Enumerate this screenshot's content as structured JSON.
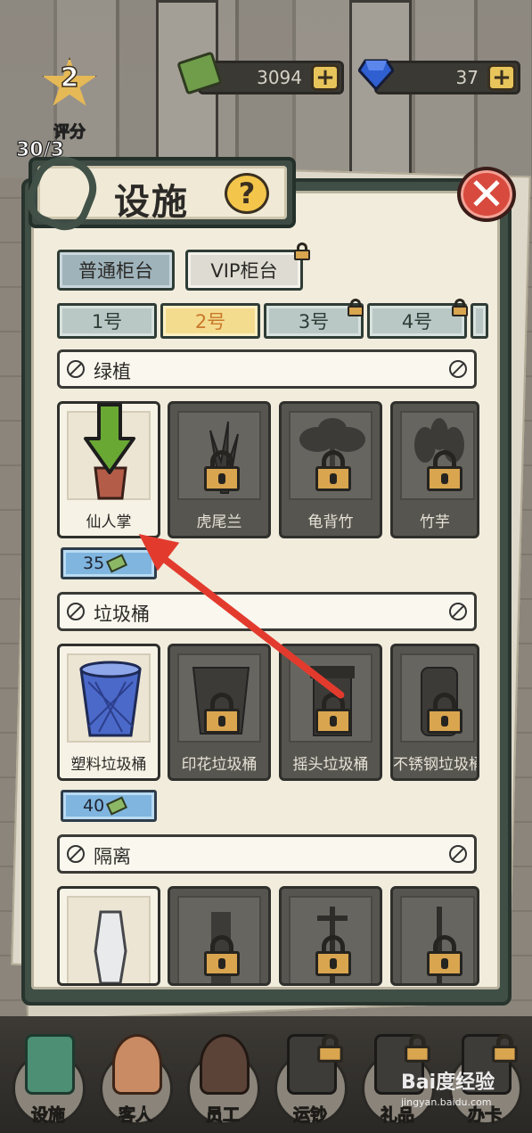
{
  "hud": {
    "cash_value": "3094",
    "gem_value": "37",
    "plus_symbol": "+",
    "rank_number": "2",
    "rank_label": "评分",
    "rank_progress": "30/3"
  },
  "panel": {
    "title": "设施",
    "help_symbol": "?",
    "close_symbol": "✕",
    "counter_tabs": [
      {
        "label": "普通柜台",
        "state": "active"
      },
      {
        "label": "VIP柜台",
        "state": "locked"
      }
    ],
    "number_tabs": [
      {
        "label": "1号",
        "state": "normal"
      },
      {
        "label": "2号",
        "state": "active"
      },
      {
        "label": "3号",
        "state": "locked"
      },
      {
        "label": "4号",
        "state": "locked"
      }
    ],
    "categories": [
      {
        "title": "绿植",
        "items": [
          {
            "name": "仙人掌",
            "locked": false,
            "icon": "cactus-icon"
          },
          {
            "name": "虎尾兰",
            "locked": true,
            "icon": "snake-plant-icon"
          },
          {
            "name": "龟背竹",
            "locked": true,
            "icon": "monstera-icon"
          },
          {
            "name": "竹芋",
            "locked": true,
            "icon": "calathea-icon"
          }
        ],
        "price": "35"
      },
      {
        "title": "垃圾桶",
        "items": [
          {
            "name": "塑料垃圾桶",
            "locked": false,
            "icon": "plastic-bin-icon"
          },
          {
            "name": "印花垃圾桶",
            "locked": true,
            "icon": "printed-bin-icon"
          },
          {
            "name": "摇头垃圾桶",
            "locked": true,
            "icon": "swing-bin-icon"
          },
          {
            "name": "不锈钢垃圾桶",
            "locked": true,
            "icon": "steel-bin-icon"
          }
        ],
        "price": "40"
      },
      {
        "title": "隔离",
        "items": [
          {
            "name": "",
            "locked": false,
            "icon": "divider-post-icon"
          },
          {
            "name": "",
            "locked": true,
            "icon": "barrier-icon"
          },
          {
            "name": "",
            "locked": true,
            "icon": "barrier-icon"
          },
          {
            "name": "",
            "locked": true,
            "icon": "barrier-icon"
          }
        ]
      }
    ]
  },
  "toolbar": {
    "items": [
      {
        "label": "设施",
        "locked": false
      },
      {
        "label": "客人",
        "locked": false
      },
      {
        "label": "员工",
        "locked": false
      },
      {
        "label": "运钞",
        "locked": true
      },
      {
        "label": "礼品",
        "locked": true
      },
      {
        "label": "办卡",
        "locked": true
      }
    ]
  },
  "watermark": {
    "brand": "Bai度经验",
    "url": "jingyan.baidu.com"
  },
  "colors": {
    "panel_frame": "#3f4f46",
    "paper": "#f1ecdc",
    "active_tab": "#f4dc8f",
    "lock_gold": "#d9a54f",
    "price_blue": "#7fb5df",
    "close_red": "#d84a3e",
    "annotation_red": "#e23b2e",
    "green_arrow": "#6aa834"
  }
}
